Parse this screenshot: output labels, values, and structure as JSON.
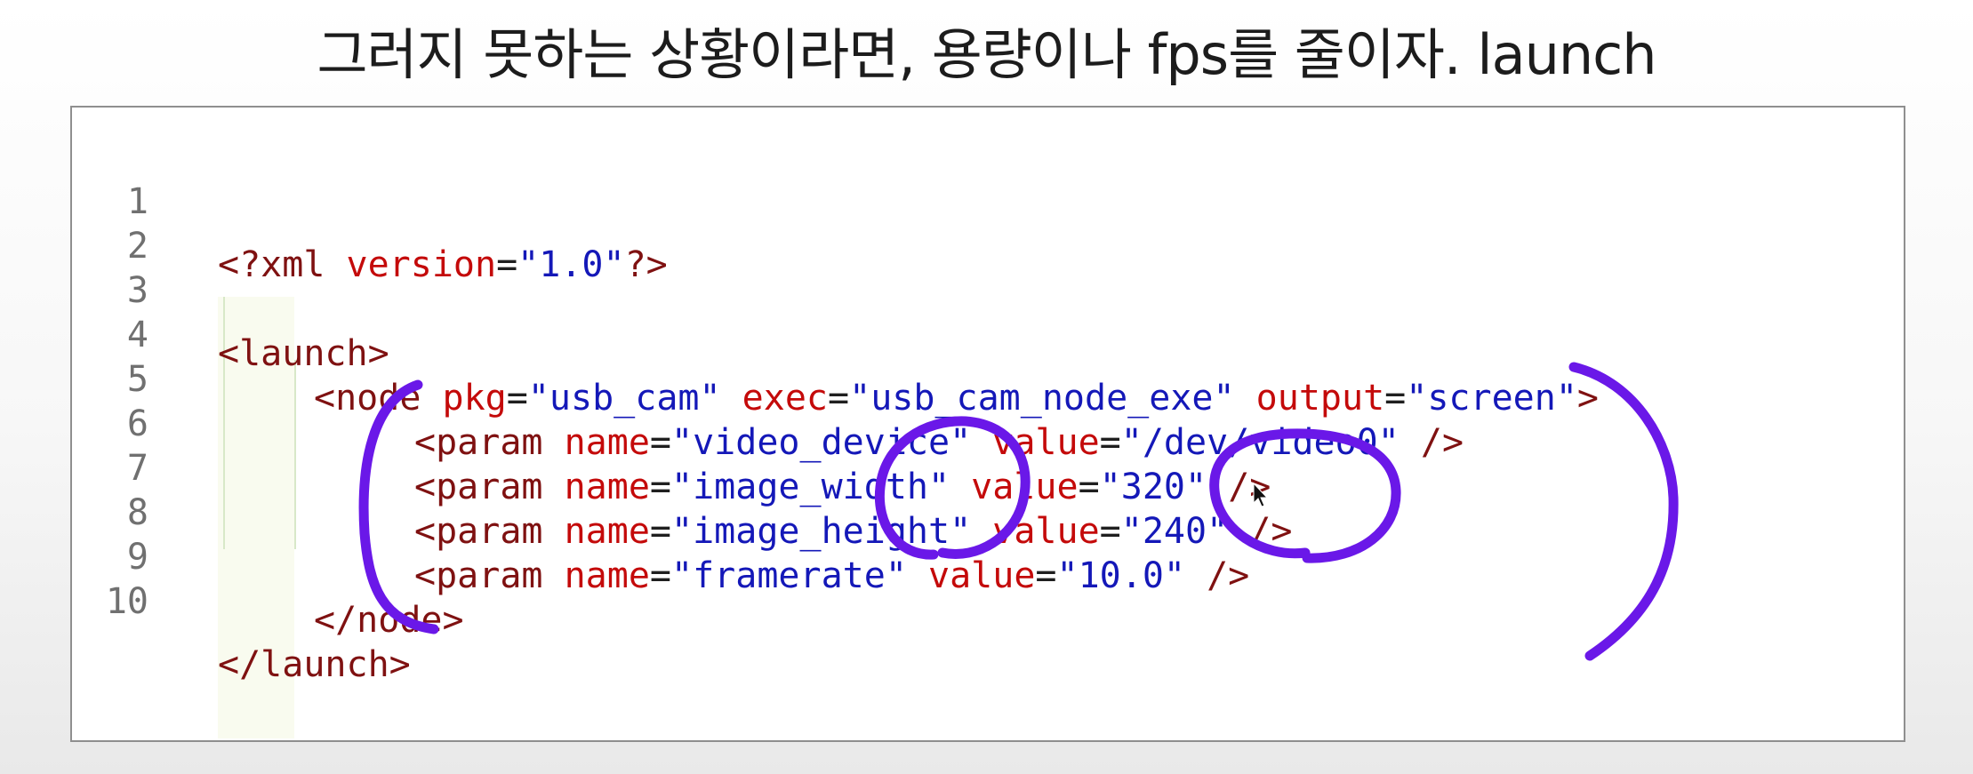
{
  "caption": "그러지 못하는 상황이라면, 용량이나 fps를 줄이자. launch",
  "editor": {
    "line_numbers": [
      "1",
      "2",
      "3",
      "4",
      "5",
      "6",
      "7",
      "8",
      "9",
      "10"
    ],
    "lines": [
      {
        "tag": "<?xml",
        "attr1": " version",
        "eq1": "=",
        "val1": "\"1.0\"",
        "close": "?>"
      },
      {},
      {
        "tag": "<launch>"
      },
      {
        "tag": "<node",
        "attr1": " pkg",
        "eq1": "=",
        "val1": "\"usb_cam\"",
        "attr2": " exec",
        "eq2": "=",
        "val2": "\"usb_cam_node_exe\"",
        "attr3": " output",
        "eq3": "=",
        "val3": "\"screen\"",
        "close": ">"
      },
      {
        "tag": "<param",
        "attr1": " name",
        "eq1": "=",
        "val1": "\"video_device\"",
        "attr2": " value",
        "eq2": "=",
        "val2": "\"/dev/video0\"",
        "close": " />"
      },
      {
        "tag": "<param",
        "attr1": " name",
        "eq1": "=",
        "val1": "\"image_width\"",
        "attr2": " value",
        "eq2": "=",
        "val2": "\"320\"",
        "close": " />"
      },
      {
        "tag": "<param",
        "attr1": " name",
        "eq1": "=",
        "val1": "\"image_height\"",
        "attr2": " value",
        "eq2": "=",
        "val2": "\"240\"",
        "close": " />"
      },
      {
        "tag": "<param",
        "attr1": " name",
        "eq1": "=",
        "val1": "\"framerate\"",
        "attr2": " value",
        "eq2": "=",
        "val2": "\"10.0\"",
        "close": " />"
      },
      {
        "tag": "</node>"
      },
      {
        "tag": "</launch>"
      }
    ]
  },
  "colors": {
    "tag": "#7f1111",
    "attribute": "#c40a0a",
    "string": "#1418b8",
    "annotation_ink": "#6a18e8"
  },
  "annotations": {
    "color": "#6a18e8",
    "marks": [
      "left-bracket-mark",
      "image-size-circle",
      "value-circle",
      "right-bracket-mark"
    ]
  }
}
